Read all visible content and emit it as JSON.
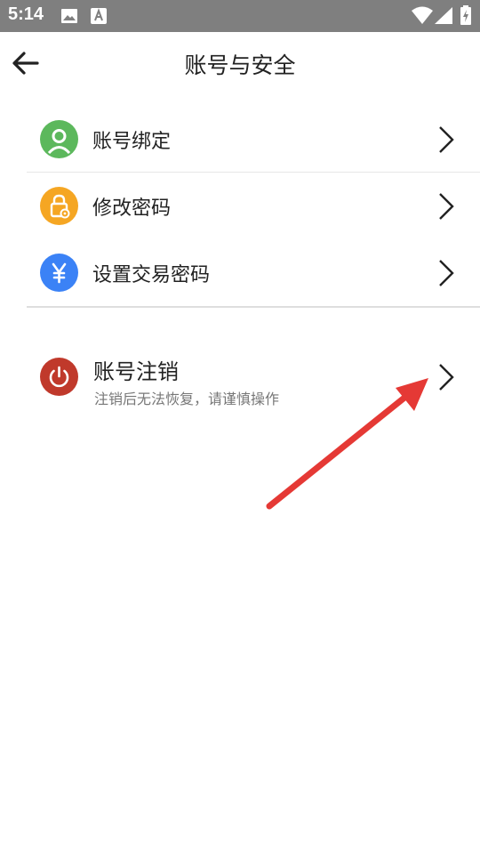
{
  "status_bar": {
    "time": "5:14"
  },
  "header": {
    "title": "账号与安全"
  },
  "menu": [
    {
      "label": "账号绑定",
      "icon": "user-icon",
      "color": "#5cb85c"
    },
    {
      "label": "修改密码",
      "icon": "lock-gear-icon",
      "color": "#f5a623"
    },
    {
      "label": "设置交易密码",
      "icon": "yuan-icon",
      "color": "#3b82f6"
    }
  ],
  "account_cancel": {
    "label": "账号注销",
    "sub": "注销后无法恢复，请谨慎操作",
    "icon": "power-icon",
    "color": "#c0392b"
  },
  "annotation_arrow_color": "#e53935"
}
